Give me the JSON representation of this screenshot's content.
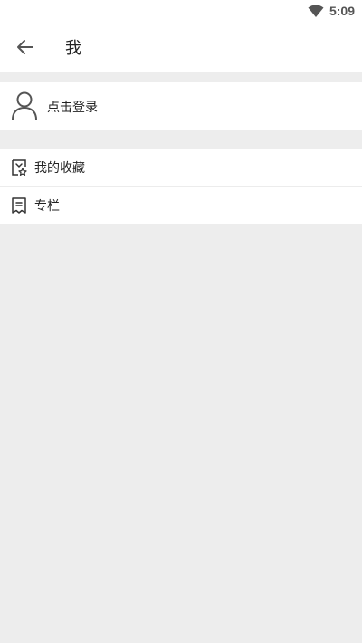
{
  "status_bar": {
    "time": "5:09",
    "icons": [
      "wifi-icon"
    ]
  },
  "app_bar": {
    "title": "我",
    "back_icon": "arrow-left-icon"
  },
  "login": {
    "label": "点击登录",
    "icon": "user-icon"
  },
  "menu": {
    "items": [
      {
        "label": "我的收藏",
        "icon": "favorites-icon"
      },
      {
        "label": "专栏",
        "icon": "column-bookmark-icon"
      }
    ]
  },
  "colors": {
    "background": "#ededed",
    "surface": "#ffffff",
    "text": "#222222",
    "icon": "#444444"
  }
}
